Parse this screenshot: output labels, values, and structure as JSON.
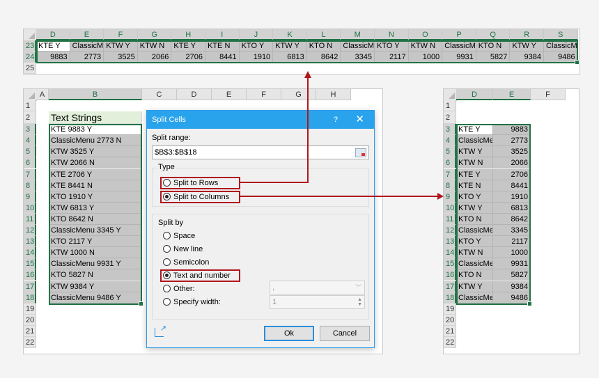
{
  "top_sheet": {
    "columns": [
      "D",
      "E",
      "F",
      "G",
      "H",
      "I",
      "J",
      "K",
      "L",
      "M",
      "N",
      "O",
      "P",
      "Q",
      "R",
      "S"
    ],
    "rows": [
      {
        "num": "23",
        "cells": [
          "KTE  Y",
          "ClassicM",
          "KTW  Y",
          "KTW  N",
          "KTE  Y",
          "KTE  N",
          "KTO  Y",
          "KTW  Y",
          "KTO  N",
          "ClassicM",
          "KTO  Y",
          "KTW  N",
          "ClassicM",
          "KTO  N",
          "KTW  Y",
          "ClassicM"
        ]
      },
      {
        "num": "24",
        "cells": [
          "9883",
          "2773",
          "3525",
          "2066",
          "2706",
          "8441",
          "1910",
          "6813",
          "8642",
          "3345",
          "2117",
          "1000",
          "9931",
          "5827",
          "9384",
          "9486"
        ]
      },
      {
        "num": "25",
        "cells": []
      }
    ]
  },
  "left_sheet": {
    "columns": [
      "A",
      "B",
      "C",
      "D",
      "E",
      "F",
      "G",
      "H"
    ],
    "row_numbers": [
      "1",
      "2",
      "3",
      "4",
      "5",
      "6",
      "7",
      "8",
      "9",
      "10",
      "11",
      "12",
      "13",
      "14",
      "15",
      "16",
      "17",
      "18",
      "19",
      "20",
      "21",
      "22"
    ],
    "header": "Text Strings",
    "values": [
      "KTE 9883 Y",
      "ClassicMenu 2773 N",
      "KTW 3525 Y",
      "KTW 2066 N",
      "KTE 2706 Y",
      "KTE 8441 N",
      "KTO 1910 Y",
      "KTW 6813 Y",
      "KTO 8642 N",
      "ClassicMenu 3345 Y",
      "KTO 2117 Y",
      "KTW 1000 N",
      "ClassicMenu 9931 Y",
      "KTO 5827 N",
      "KTW 9384 Y",
      "ClassicMenu 9486 Y"
    ]
  },
  "right_sheet": {
    "columns": [
      "D",
      "E",
      "F"
    ],
    "row_numbers": [
      "1",
      "2",
      "3",
      "4",
      "5",
      "6",
      "7",
      "8",
      "9",
      "10",
      "11",
      "12",
      "13",
      "14",
      "15",
      "16",
      "17",
      "18",
      "19",
      "20",
      "21",
      "22"
    ],
    "rows": [
      [
        "KTE  Y",
        "9883"
      ],
      [
        "ClassicMe",
        "2773"
      ],
      [
        "KTW  Y",
        "3525"
      ],
      [
        "KTW  N",
        "2066"
      ],
      [
        "KTE  Y",
        "2706"
      ],
      [
        "KTE  N",
        "8441"
      ],
      [
        "KTO  Y",
        "1910"
      ],
      [
        "KTW  Y",
        "6813"
      ],
      [
        "KTO  N",
        "8642"
      ],
      [
        "ClassicMe",
        "3345"
      ],
      [
        "KTO  Y",
        "2117"
      ],
      [
        "KTW  N",
        "1000"
      ],
      [
        "ClassicMe",
        "9931"
      ],
      [
        "KTO  N",
        "5827"
      ],
      [
        "KTW  Y",
        "9384"
      ],
      [
        "ClassicMe",
        "9486"
      ]
    ]
  },
  "dialog": {
    "title": "Split Cells",
    "help": "?",
    "close": "✕",
    "split_range_label": "Split range:",
    "split_range_value": "$B$3:$B$18",
    "type_label": "Type",
    "type_options": [
      {
        "label": "Split to Rows",
        "selected": false
      },
      {
        "label": "Split to Columns",
        "selected": true
      }
    ],
    "split_by_label": "Split by",
    "split_by_options": [
      {
        "label": "Space",
        "selected": false
      },
      {
        "label": "New line",
        "selected": false
      },
      {
        "label": "Semicolon",
        "selected": false
      },
      {
        "label": "Text and number",
        "selected": true
      },
      {
        "label": "Other:",
        "selected": false
      },
      {
        "label": "Specify width:",
        "selected": false
      }
    ],
    "other_value": ",",
    "width_value": "1",
    "ok_label": "Ok",
    "cancel_label": "Cancel"
  },
  "colors": {
    "selection": "#217346",
    "highlight": "#b0161c",
    "title_bar": "#29a3ec",
    "header_fill": "#e2efda"
  }
}
